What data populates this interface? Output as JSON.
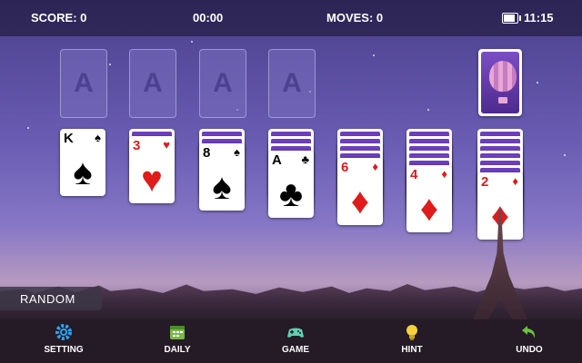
{
  "status": {
    "score_label": "SCORE: 0",
    "timer": "00:00",
    "moves_label": "MOVES: 0",
    "clock": "11:15"
  },
  "foundations": [
    {
      "label": "A"
    },
    {
      "label": "A"
    },
    {
      "label": "A"
    },
    {
      "label": "A"
    }
  ],
  "tableau": [
    {
      "facedown": 0,
      "card": {
        "rank": "K",
        "suit": "♠",
        "color": "black"
      }
    },
    {
      "facedown": 1,
      "card": {
        "rank": "3",
        "suit": "♥",
        "color": "red"
      }
    },
    {
      "facedown": 2,
      "card": {
        "rank": "8",
        "suit": "♠",
        "color": "black"
      }
    },
    {
      "facedown": 3,
      "card": {
        "rank": "A",
        "suit": "♣",
        "color": "black"
      }
    },
    {
      "facedown": 4,
      "card": {
        "rank": "6",
        "suit": "♦",
        "color": "red"
      }
    },
    {
      "facedown": 5,
      "card": {
        "rank": "4",
        "suit": "♦",
        "color": "red"
      }
    },
    {
      "facedown": 6,
      "card": {
        "rank": "2",
        "suit": "♦",
        "color": "red"
      }
    }
  ],
  "random_label": "RANDOM",
  "toolbar": {
    "setting": {
      "label": "SETTING",
      "icon": "gear-icon"
    },
    "daily": {
      "label": "DAILY",
      "icon": "calendar-icon"
    },
    "game": {
      "label": "GAME",
      "icon": "gamepad-icon"
    },
    "hint": {
      "label": "HINT",
      "icon": "lightbulb-icon"
    },
    "undo": {
      "label": "UNDO",
      "icon": "undo-arrow-icon"
    }
  },
  "colors": {
    "card_back": "#6c3fbd",
    "red_suit": "#e01b1b",
    "toolbar_bg": "#241b26"
  }
}
